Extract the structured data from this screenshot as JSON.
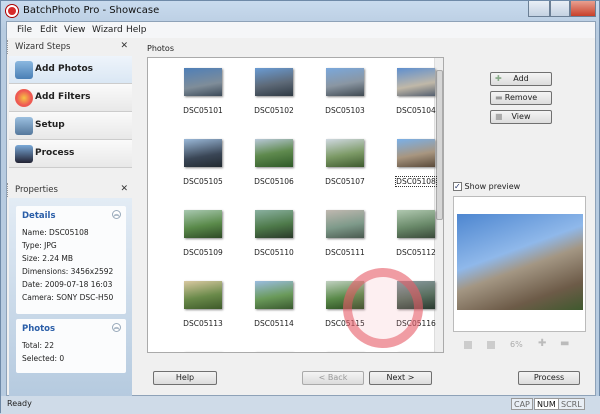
{
  "window": {
    "title": "BatchPhoto Pro - Showcase"
  },
  "menu": [
    "File",
    "Edit",
    "View",
    "Wizard",
    "Help"
  ],
  "wizard": {
    "header": "Wizard Steps",
    "steps": [
      "Add Photos",
      "Add Filters",
      "Setup",
      "Process"
    ]
  },
  "properties": {
    "header": "Properties",
    "details": {
      "title": "Details",
      "lines": [
        "Name: DSC05108",
        "Type: JPG",
        "Size: 2.24 MB",
        "Dimensions: 3456x2592",
        "Date: 2009-07-18 16:03",
        "Camera: SONY DSC-H50"
      ]
    },
    "photos": {
      "title": "Photos",
      "lines": [
        "Total: 22",
        "Selected: 0"
      ]
    }
  },
  "photos": {
    "label": "Photos",
    "items": [
      "DSC05101",
      "DSC05102",
      "DSC05103",
      "DSC05104",
      "DSC05105",
      "DSC05106",
      "DSC05107",
      "DSC05108",
      "DSC05109",
      "DSC05110",
      "DSC05111",
      "DSC05112",
      "DSC05113",
      "DSC05114",
      "DSC05115",
      "DSC05116"
    ],
    "selected": "DSC05108"
  },
  "side_buttons": {
    "add": "Add",
    "remove": "Remove",
    "view": "View"
  },
  "preview": {
    "show_label": "Show preview",
    "checked": true,
    "zoom": "6%"
  },
  "footer": {
    "help": "Help",
    "back": "< Back",
    "next": "Next >",
    "process": "Process"
  },
  "status": {
    "text": "Ready",
    "indicators": [
      "CAP",
      "NUM",
      "SCRL"
    ]
  }
}
